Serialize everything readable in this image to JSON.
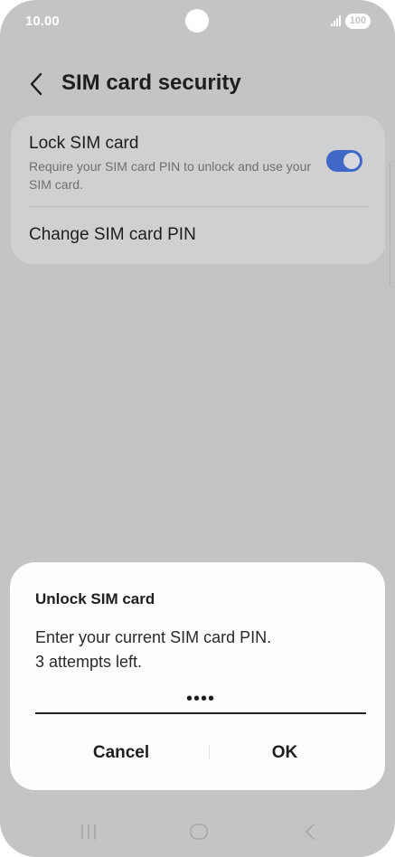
{
  "status_bar": {
    "time": "10.00",
    "battery": "100"
  },
  "header": {
    "title": "SIM card security"
  },
  "settings": {
    "lock_sim": {
      "title": "Lock SIM card",
      "description": "Require your SIM card PIN to unlock and use your SIM card.",
      "enabled": true
    },
    "change_pin_label": "Change SIM card PIN"
  },
  "dialog": {
    "title": "Unlock SIM card",
    "message_line1": "Enter your current SIM card PIN.",
    "message_line2": "3 attempts left.",
    "pin_value": "••••",
    "cancel_label": "Cancel",
    "ok_label": "OK"
  },
  "icons": {
    "back": "chevron-left-icon",
    "nav_recents": "recents-icon",
    "nav_home": "home-icon",
    "nav_back": "nav-back-icon"
  },
  "colors": {
    "toggle_on": "#3e67c6",
    "dim_background": "#c4c4c6",
    "dialog_background": "#fdfdfd"
  }
}
